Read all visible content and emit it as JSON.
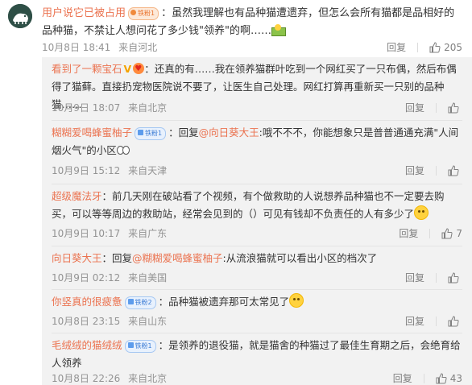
{
  "main_comment": {
    "user": "用户说它已被占用",
    "badge": "铁粉1",
    "text": "：虽然我理解也有品种猫遭遗弃，但怎么会所有猫都是品相好的品种猫，不禁让人想问花了多少钱\"领养\"的啊……",
    "time": "10月8日 18:41",
    "location": "来自河北",
    "reply_label": "回复",
    "likes": "205"
  },
  "replies": [
    {
      "user": "看到了一颗宝石",
      "text": "：还真的有……我在领养猫群叶吃到一个网红买了一只布偶，然后布偶得了猫藓。直接扔宠物医院说不要了，让医生自己处理。网红打算再重新买一只别的品种猫……",
      "time": "10月9日 18:07",
      "location": "来自北京",
      "reply_label": "回复",
      "likes": ""
    },
    {
      "user": "糊糊爱喝蜂蜜柚子",
      "badge": "铁粉1",
      "prefix": "：回复",
      "mention": "@向日葵大王",
      "text": ":哦不不不，你能想象只是普普通通充满\"人间烟火气\"的小区",
      "time": "10月9日 15:12",
      "location": "来自天津",
      "reply_label": "回复",
      "likes": ""
    },
    {
      "user": "超级魔法牙",
      "text": "：前几天刚在破站看了个视频，有个做救助的人说想养品种猫也不一定要去购买，可以等等周边的救助站，经常会见到的（）可见有钱却不负责任的人有多少了",
      "time": "10月9日 10:17",
      "location": "来自广东",
      "reply_label": "回复",
      "likes": "7"
    },
    {
      "user": "向日葵大王",
      "prefix": "：回复",
      "mention": "@糊糊爱喝蜂蜜柚子",
      "text": ":从流浪猫就可以看出小区的档次了",
      "time": "10月9日 02:12",
      "location": "来自美国",
      "reply_label": "回复",
      "likes": ""
    },
    {
      "user": "你竖真的很疲惫",
      "badge": "铁粉2",
      "text": "：品种猫被遗弃那可太常见了",
      "time": "10月8日 23:15",
      "location": "来自山东",
      "reply_label": "回复",
      "likes": ""
    },
    {
      "user": "毛绒绒的猫绒绒",
      "badge": "铁粉1",
      "text": "：是领养的退役猫，就是猫舍的种猫过了最佳生育期之后，会绝育给人领养",
      "time": "10月8日 22:26",
      "location": "来自北京",
      "reply_label": "回复",
      "likes": "43"
    }
  ],
  "colors": {
    "username": "#eb7350",
    "reply_bg": "#f2f2f2",
    "meta": "#939393",
    "badge_blue": "#3a7bd5"
  },
  "icons": [
    "share-icon",
    "like-icon",
    "emoji-icon"
  ]
}
